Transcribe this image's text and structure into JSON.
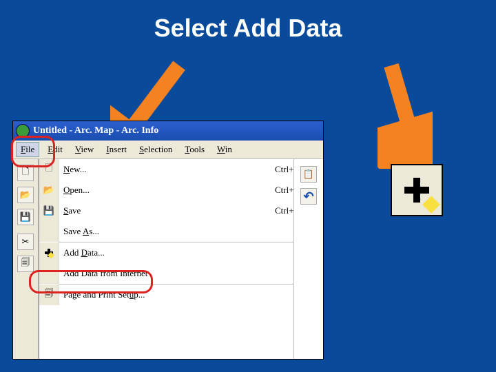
{
  "slide": {
    "title": "Select Add Data"
  },
  "window": {
    "title": "Untitled - Arc. Map - Arc. Info",
    "menus": {
      "file": "File",
      "edit": "Edit",
      "view": "View",
      "insert": "Insert",
      "selection": "Selection",
      "tools": "Tools",
      "window": "Win"
    },
    "fileMenu": {
      "new": {
        "label": "New...",
        "shortcut": "Ctrl+N"
      },
      "open": {
        "label": "Open...",
        "shortcut": "Ctrl+O"
      },
      "save": {
        "label": "Save",
        "shortcut": "Ctrl+S"
      },
      "saveAs": {
        "label": "Save As..."
      },
      "addData": {
        "label": "Add Data..."
      },
      "addDataNet": {
        "label": "Add Data from Internet"
      },
      "pageSetup": {
        "label": "Page and Print Setup..."
      }
    }
  },
  "icons": {
    "plusButton": "add-data-button"
  },
  "colors": {
    "accent": "#f58220",
    "highlight": "#d22",
    "bg": "#0a4a9a"
  }
}
